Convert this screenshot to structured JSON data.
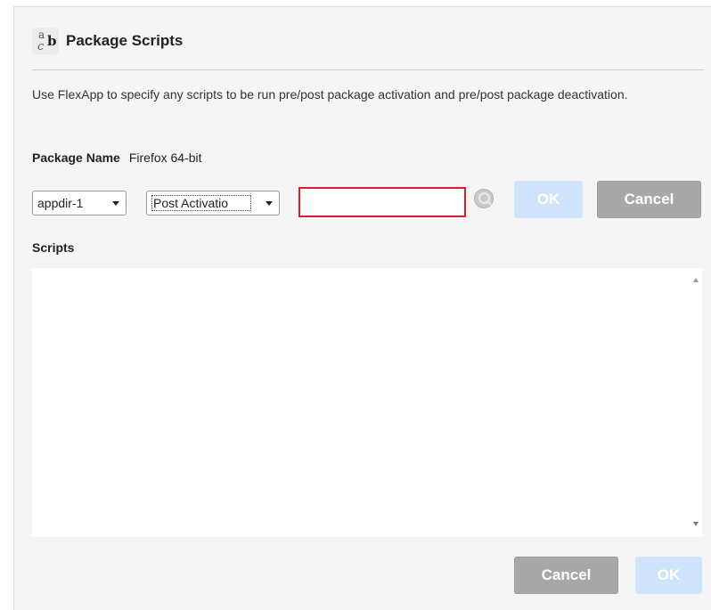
{
  "dialog": {
    "title": "Package Scripts",
    "icon": "spell-check-icon",
    "description": "Use FlexApp to specify any scripts to be run pre/post package activation and pre/post package deactivation."
  },
  "package": {
    "label": "Package Name",
    "value": "Firefox 64-bit"
  },
  "controls": {
    "target_select": "appdir-1",
    "event_select": "Post Activatio",
    "script_input_value": "",
    "search_icon": "search-icon",
    "ok_label": "OK",
    "cancel_label": "Cancel"
  },
  "scripts": {
    "label": "Scripts",
    "content": ""
  },
  "footer": {
    "cancel_label": "Cancel",
    "ok_label": "OK"
  },
  "colors": {
    "ok_disabled": "#cfe4fb",
    "cancel": "#a8a8a8",
    "input_error_border": "#d9202a"
  }
}
